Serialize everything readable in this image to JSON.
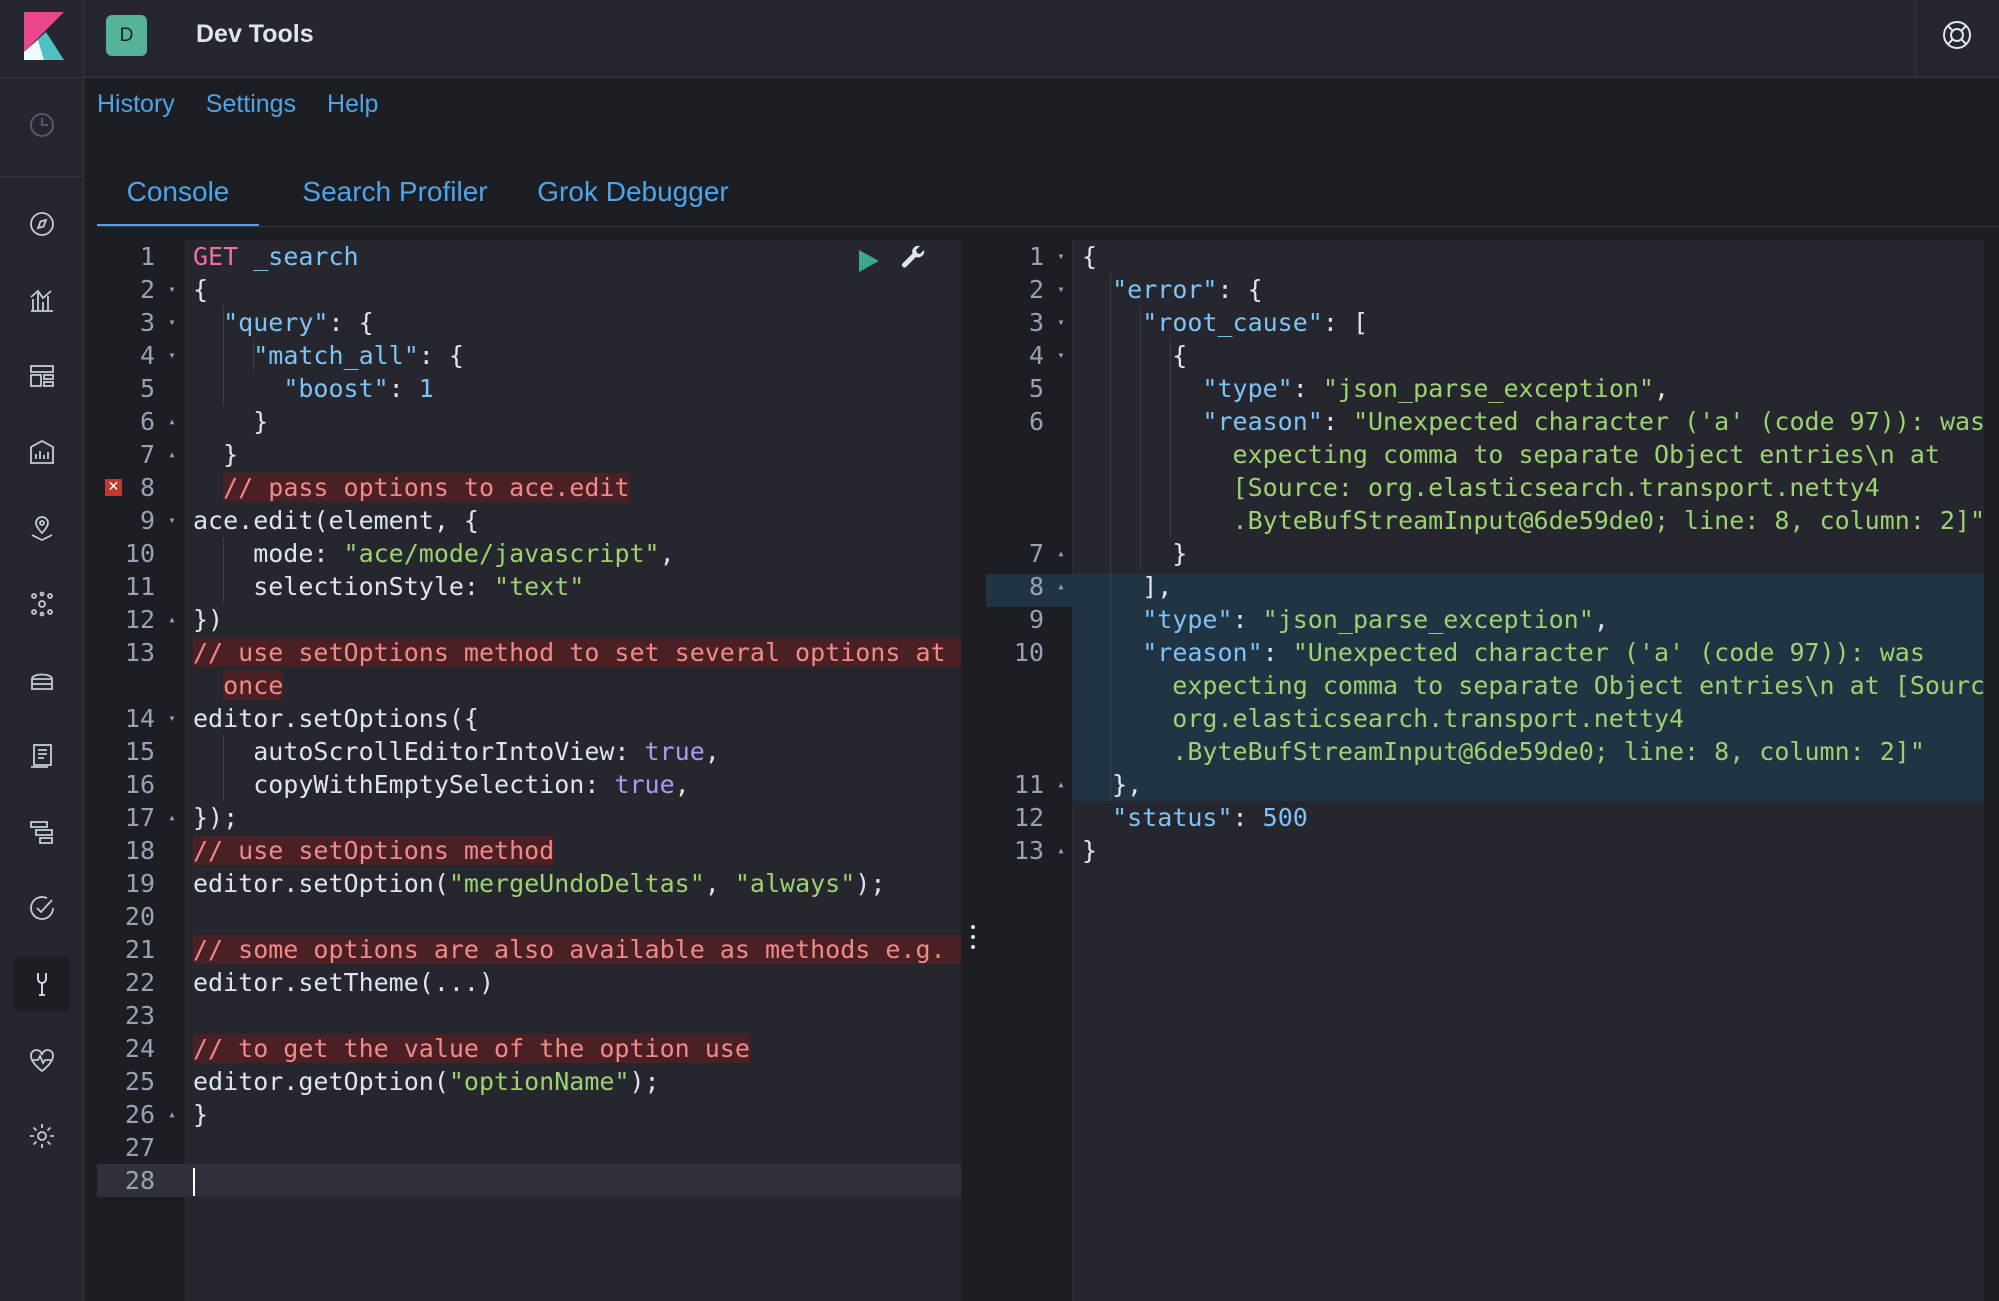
{
  "header": {
    "avatar_letter": "D",
    "title": "Dev Tools"
  },
  "nav_icons": [
    "recent-clock-icon",
    "discover-compass-icon",
    "visualize-chart-icon",
    "dashboard-icon",
    "canvas-icon",
    "maps-icon",
    "ml-icon",
    "infrastructure-icon",
    "logs-icon",
    "apm-icon",
    "uptime-icon",
    "dev-tools-icon",
    "monitoring-icon",
    "management-gear-icon"
  ],
  "submenu": {
    "history": "History",
    "settings": "Settings",
    "help": "Help"
  },
  "tabs": [
    {
      "label": "Console",
      "active": true
    },
    {
      "label": "Search Profiler",
      "active": false
    },
    {
      "label": "Grok Debugger",
      "active": false
    }
  ],
  "request_editor": {
    "lines": [
      {
        "n": "1",
        "fold": "",
        "tokens": [
          [
            "k-kw",
            "GET"
          ],
          [
            "k-plain",
            " "
          ],
          [
            "k-blue",
            "_search"
          ]
        ]
      },
      {
        "n": "2",
        "fold": "▾",
        "tokens": [
          [
            "k-plain",
            "{"
          ]
        ]
      },
      {
        "n": "3",
        "fold": "▾",
        "tokens": [
          [
            "k-plain",
            "  "
          ],
          [
            "k-key",
            "\"query\""
          ],
          [
            "k-plain",
            ": {"
          ]
        ]
      },
      {
        "n": "4",
        "fold": "▾",
        "tokens": [
          [
            "k-plain",
            "    "
          ],
          [
            "k-key",
            "\"match_all\""
          ],
          [
            "k-plain",
            ": {"
          ]
        ]
      },
      {
        "n": "5",
        "fold": "",
        "tokens": [
          [
            "k-plain",
            "      "
          ],
          [
            "k-key",
            "\"boost\""
          ],
          [
            "k-plain",
            ": "
          ],
          [
            "k-num",
            "1"
          ]
        ]
      },
      {
        "n": "6",
        "fold": "▴",
        "tokens": [
          [
            "k-plain",
            "    }"
          ]
        ]
      },
      {
        "n": "7",
        "fold": "▴",
        "tokens": [
          [
            "k-plain",
            "  }"
          ]
        ]
      },
      {
        "n": "8",
        "fold": "",
        "error": true,
        "tokens": [
          [
            "k-plain",
            "  "
          ],
          [
            "k-cmt hl-cmt",
            "// pass options to ace.edit"
          ]
        ]
      },
      {
        "n": "9",
        "fold": "▾",
        "tokens": [
          [
            "k-plain",
            "ace.edit(element, {"
          ]
        ]
      },
      {
        "n": "10",
        "fold": "",
        "tokens": [
          [
            "k-plain",
            "    mode: "
          ],
          [
            "k-str",
            "\"ace/mode/javascript\""
          ],
          [
            "k-plain",
            ","
          ]
        ]
      },
      {
        "n": "11",
        "fold": "",
        "tokens": [
          [
            "k-plain",
            "    selectionStyle: "
          ],
          [
            "k-str",
            "\"text\""
          ]
        ]
      },
      {
        "n": "12",
        "fold": "▴",
        "tokens": [
          [
            "k-plain",
            "})"
          ]
        ]
      },
      {
        "n": "13",
        "fold": "",
        "tokens": [
          [
            "k-cmt hl-cmt",
            "// use setOptions method to set several options at "
          ]
        ]
      },
      {
        "n": "",
        "fold": "",
        "tokens": [
          [
            "k-plain",
            "  "
          ],
          [
            "k-cmt hl-cmt",
            "once"
          ]
        ]
      },
      {
        "n": "14",
        "fold": "▾",
        "tokens": [
          [
            "k-plain",
            "editor.setOptions({"
          ]
        ]
      },
      {
        "n": "15",
        "fold": "",
        "tokens": [
          [
            "k-plain",
            "    autoScrollEditorIntoView: "
          ],
          [
            "k-bool",
            "true"
          ],
          [
            "k-plain",
            ","
          ]
        ]
      },
      {
        "n": "16",
        "fold": "",
        "tokens": [
          [
            "k-plain",
            "    copyWithEmptySelection: "
          ],
          [
            "k-bool",
            "true"
          ],
          [
            "k-plain",
            ","
          ]
        ]
      },
      {
        "n": "17",
        "fold": "▴",
        "tokens": [
          [
            "k-plain",
            "});"
          ]
        ]
      },
      {
        "n": "18",
        "fold": "",
        "tokens": [
          [
            "k-cmt hl-cmt",
            "// use setOptions method"
          ]
        ]
      },
      {
        "n": "19",
        "fold": "",
        "tokens": [
          [
            "k-plain",
            "editor.setOption("
          ],
          [
            "k-str",
            "\"mergeUndoDeltas\""
          ],
          [
            "k-plain",
            ", "
          ],
          [
            "k-str",
            "\"always\""
          ],
          [
            "k-plain",
            ");"
          ]
        ]
      },
      {
        "n": "20",
        "fold": "",
        "tokens": []
      },
      {
        "n": "21",
        "fold": "",
        "tokens": [
          [
            "k-cmt hl-cmt",
            "// some options are also available as methods e.g. "
          ]
        ]
      },
      {
        "n": "22",
        "fold": "",
        "tokens": [
          [
            "k-plain",
            "editor.setTheme(...)"
          ]
        ]
      },
      {
        "n": "23",
        "fold": "",
        "tokens": []
      },
      {
        "n": "24",
        "fold": "",
        "tokens": [
          [
            "k-cmt hl-cmt",
            "// to get the value of the option use"
          ]
        ]
      },
      {
        "n": "25",
        "fold": "",
        "tokens": [
          [
            "k-plain",
            "editor.getOption("
          ],
          [
            "k-str",
            "\"optionName\""
          ],
          [
            "k-plain",
            ");"
          ]
        ]
      },
      {
        "n": "26",
        "fold": "▴",
        "tokens": [
          [
            "k-plain",
            "}"
          ]
        ]
      },
      {
        "n": "27",
        "fold": "",
        "tokens": []
      },
      {
        "n": "28",
        "fold": "",
        "cursor": true,
        "tokens": []
      }
    ]
  },
  "response_editor": {
    "lines": [
      {
        "n": "1",
        "fold": "▾",
        "tokens": [
          [
            "k-plain",
            "{"
          ]
        ]
      },
      {
        "n": "2",
        "fold": "▾",
        "tokens": [
          [
            "k-plain",
            "  "
          ],
          [
            "k-key",
            "\"error\""
          ],
          [
            "k-plain",
            ": {"
          ]
        ]
      },
      {
        "n": "3",
        "fold": "▾",
        "tokens": [
          [
            "k-plain",
            "    "
          ],
          [
            "k-key",
            "\"root_cause\""
          ],
          [
            "k-plain",
            ": ["
          ]
        ]
      },
      {
        "n": "4",
        "fold": "▾",
        "tokens": [
          [
            "k-plain",
            "      {"
          ]
        ]
      },
      {
        "n": "5",
        "fold": "",
        "tokens": [
          [
            "k-plain",
            "        "
          ],
          [
            "k-key",
            "\"type\""
          ],
          [
            "k-plain",
            ": "
          ],
          [
            "k-str",
            "\"json_parse_exception\""
          ],
          [
            "k-plain",
            ","
          ]
        ]
      },
      {
        "n": "6",
        "fold": "",
        "tokens": [
          [
            "k-plain",
            "        "
          ],
          [
            "k-key",
            "\"reason\""
          ],
          [
            "k-plain",
            ": "
          ],
          [
            "k-str",
            "\"Unexpected character ('a' (code 97)): was"
          ]
        ]
      },
      {
        "n": "",
        "fold": "",
        "tokens": [
          [
            "k-str",
            "          expecting comma to separate Object entries\\n at"
          ]
        ]
      },
      {
        "n": "",
        "fold": "",
        "tokens": [
          [
            "k-str",
            "          [Source: org.elasticsearch.transport.netty4"
          ]
        ]
      },
      {
        "n": "",
        "fold": "",
        "tokens": [
          [
            "k-str",
            "          .ByteBufStreamInput@6de59de0; line: 8, column: 2]\""
          ]
        ]
      },
      {
        "n": "7",
        "fold": "▴",
        "tokens": [
          [
            "k-plain",
            "      }"
          ]
        ]
      },
      {
        "n": "8",
        "fold": "▴",
        "tokens": [
          [
            "k-plain",
            "    ],"
          ]
        ]
      },
      {
        "n": "9",
        "fold": "",
        "tokens": [
          [
            "k-plain",
            "    "
          ],
          [
            "k-key",
            "\"type\""
          ],
          [
            "k-plain",
            ": "
          ],
          [
            "k-str",
            "\"json_parse_exception\""
          ],
          [
            "k-plain",
            ","
          ]
        ]
      },
      {
        "n": "10",
        "fold": "",
        "tokens": [
          [
            "k-plain",
            "    "
          ],
          [
            "k-key",
            "\"reason\""
          ],
          [
            "k-plain",
            ": "
          ],
          [
            "k-str",
            "\"Unexpected character ('a' (code 97)): was"
          ]
        ]
      },
      {
        "n": "",
        "fold": "",
        "tokens": [
          [
            "k-str",
            "      expecting comma to separate Object entries\\n at [Source:"
          ]
        ]
      },
      {
        "n": "",
        "fold": "",
        "tokens": [
          [
            "k-str",
            "      org.elasticsearch.transport.netty4"
          ]
        ]
      },
      {
        "n": "",
        "fold": "",
        "tokens": [
          [
            "k-str",
            "      .ByteBufStreamInput@6de59de0; line: 8, column: 2]\""
          ]
        ]
      },
      {
        "n": "11",
        "fold": "▴",
        "tokens": [
          [
            "k-plain",
            "  },"
          ]
        ]
      },
      {
        "n": "12",
        "fold": "",
        "tokens": [
          [
            "k-plain",
            "  "
          ],
          [
            "k-key",
            "\"status\""
          ],
          [
            "k-plain",
            ": "
          ],
          [
            "k-num",
            "500"
          ]
        ]
      },
      {
        "n": "13",
        "fold": "▴",
        "tokens": [
          [
            "k-plain",
            "}"
          ]
        ]
      }
    ]
  },
  "colors": {
    "accent": "#4fa4e8",
    "avatar": "#54b399",
    "error": "#c0392b"
  }
}
